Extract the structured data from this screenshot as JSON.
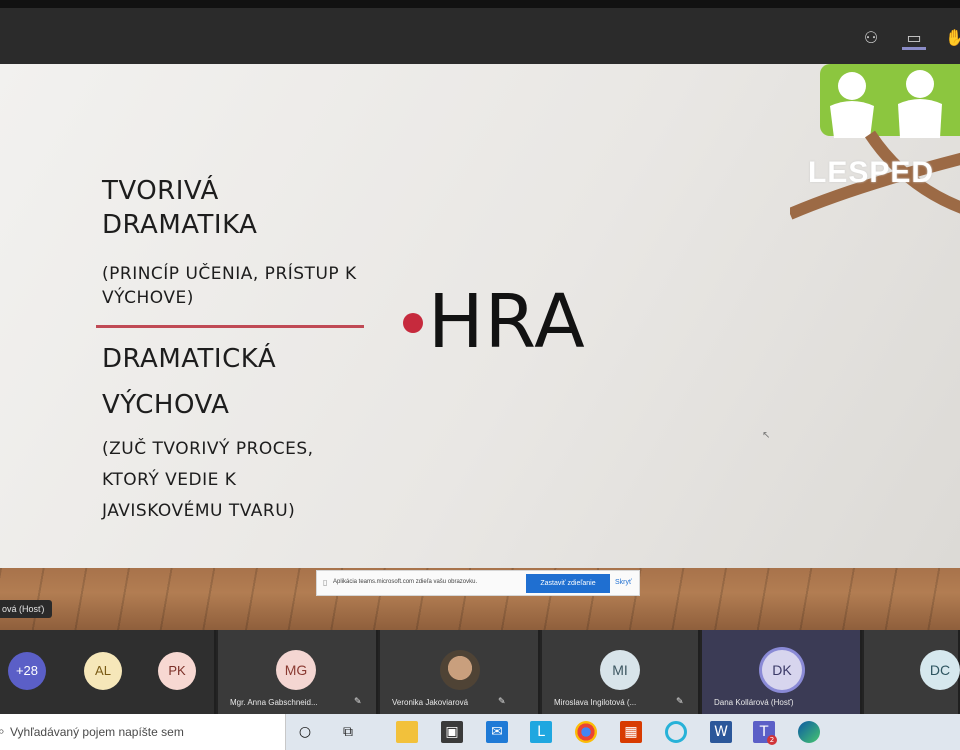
{
  "toolbar": {
    "icons": [
      "people-icon",
      "chat-icon",
      "raise-hand-icon"
    ]
  },
  "slide": {
    "title1": "TVORIVÁ DRAMATIKA",
    "subtitle1": "(PRINCÍP UČENIA, PRÍSTUP K VÝCHOVE)",
    "title2": "DRAMATICKÁ VÝCHOVA",
    "subtitle2": "(ZUČ TVORIVÝ PROCES, KTORÝ VEDIE K JAVISKOVÉMU TVARU)",
    "keyword": "HRA",
    "logo_text": "LESPED"
  },
  "notice": {
    "text": "Aplikácia teams.microsoft.com zdieľa vašu obrazovku.",
    "stop_label": "Zastaviť zdieľanie",
    "hide_label": "Skryť"
  },
  "host_tag": "ová (Hosť)",
  "participants": {
    "overflow": "+28",
    "avatars": [
      {
        "initials": "AL",
        "color": "#f6e7b9",
        "text_color": "#7a5b15"
      },
      {
        "initials": "PK",
        "color": "#f7d8d2",
        "text_color": "#7c3028"
      }
    ],
    "tiles": [
      {
        "initials": "MG",
        "name": "Mgr. Anna Gabschneid...",
        "color": "#f4d6d2",
        "text_color": "#8a3a32"
      },
      {
        "initials": "",
        "name": "Veronika Jakoviarová",
        "color": "#c9a27e",
        "text_color": "#333"
      },
      {
        "initials": "MI",
        "name": "Miroslava Ingilotová (...",
        "color": "#d8e4ea",
        "text_color": "#3c5661"
      },
      {
        "initials": "DK",
        "name": "Dana Kollárová (Hosť)",
        "color": "#d7d5ee",
        "text_color": "#3b3a68"
      },
      {
        "initials": "DC",
        "name": "",
        "color": "#d6e8ee",
        "text_color": "#2f5661"
      }
    ]
  },
  "taskbar": {
    "search_placeholder": "Vyhľadávaný pojem napíšte sem",
    "apps": [
      "cortana-icon",
      "task-view-icon",
      "file-explorer-icon",
      "store-icon",
      "mail-icon",
      "l-app-icon",
      "chrome-icon",
      "office-icon",
      "photos-icon",
      "word-icon",
      "teams-icon",
      "edge-icon"
    ],
    "teams_badge": "2"
  }
}
